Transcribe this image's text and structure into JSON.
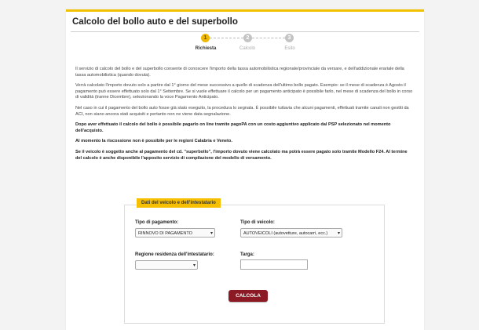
{
  "page": {
    "title": "Calcolo del bollo auto e del superbollo"
  },
  "steps": [
    {
      "number": "1",
      "label": "Richiesta",
      "active": true
    },
    {
      "number": "2",
      "label": "Calcolo",
      "active": false
    },
    {
      "number": "3",
      "label": "Esito",
      "active": false
    }
  ],
  "intro": {
    "p1": "Il servizio di calcolo del bollo e del superbollo consente di conoscere l'importo della tassa automobilistica regionale/provinciale da versare, e dell'addizionale erariale della tassa automobilistica (quando dovuta).",
    "p2": "Verrà calcolato l'importo dovuto solo a partire dal 1° giorno del mese successivo a quello di scadenza dell'ultimo bollo pagato. Esempio: se il mese di scadenza è Agosto il pagamento può essere effettuato solo dal 1° Settembre. Se si vuole effettuare il calcolo per un pagamento anticipato è possibile farlo, nel mese di scadenza del bollo in corso di validità (tranne Dicembre), selezionando la voce Pagamento Anticipato.",
    "p3": "Nel caso in cui il pagamento del bollo auto fosse già stato eseguito, la procedura lo segnala. È possibile tuttavia che alcuni pagamenti, effettuati tramite canali non gestiti da ACI, non siano ancora stati acquisiti e pertanto non ne viene data segnalazione.",
    "p4": "Dopo aver effettuato il calcolo del bollo è possibile pagarlo on line tramite pagoPA con un costo aggiuntivo applicato dal PSP selezionato nel momento dell'acquisto.",
    "p5": "Al momento la riscossione non è possibile per le regioni Calabria e Veneto.",
    "p6": "Se il veicolo è soggetto anche al pagamento del cd. \"superbollo\", l'importo dovuto viene calcolato ma potrà essere pagato solo tramite Modello F24. Al termine del calcolo è anche disponibile l'apposito servizio di compilazione del modello di versamento."
  },
  "form": {
    "legend": "Dati del veicolo e dell'intestatario",
    "payment_type_label": "Tipo di pagamento:",
    "payment_type_value": "RINNOVO DI PAGAMENTO",
    "vehicle_type_label": "Tipo di veicolo:",
    "vehicle_type_value": "AUTOVEICOLI (autovetture, autocarri, ecc.)",
    "region_label": "Regione residenza dell'intestatario:",
    "region_value": "",
    "plate_label": "Targa:",
    "plate_value": "",
    "submit_label": "CALCOLA"
  },
  "colors": {
    "accent": "#f2c200",
    "button": "#8b1a24",
    "step_active": "#f0b800",
    "step_inactive": "#c4c4c4"
  }
}
